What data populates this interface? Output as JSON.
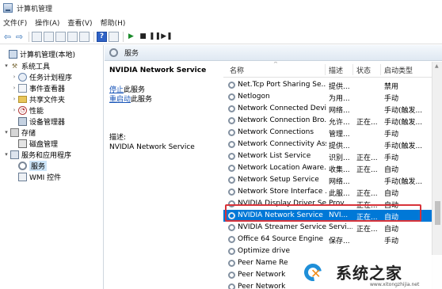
{
  "window": {
    "title": "计算机管理"
  },
  "menu": [
    "文件(F)",
    "操作(A)",
    "查看(V)",
    "帮助(H)"
  ],
  "tree": [
    {
      "label": "计算机管理(本地)",
      "level": 0,
      "caret": "",
      "icon": "computer-icon"
    },
    {
      "label": "系统工具",
      "level": 1,
      "caret": "▾",
      "icon": "tools-icon"
    },
    {
      "label": "任务计划程序",
      "level": 2,
      "caret": "›",
      "icon": "clock-icon"
    },
    {
      "label": "事件查看器",
      "level": 2,
      "caret": "›",
      "icon": "event-viewer-icon"
    },
    {
      "label": "共享文件夹",
      "level": 2,
      "caret": "›",
      "icon": "folder-icon"
    },
    {
      "label": "性能",
      "level": 2,
      "caret": "›",
      "icon": "performance-icon"
    },
    {
      "label": "设备管理器",
      "level": 2,
      "caret": "",
      "icon": "device-manager-icon"
    },
    {
      "label": "存储",
      "level": 1,
      "caret": "▾",
      "icon": "storage-icon"
    },
    {
      "label": "磁盘管理",
      "level": 2,
      "caret": "",
      "icon": "disk-icon"
    },
    {
      "label": "服务和应用程序",
      "level": 1,
      "caret": "▾",
      "icon": "services-apps-icon"
    },
    {
      "label": "服务",
      "level": 2,
      "caret": "",
      "icon": "gear-icon",
      "selected": true
    },
    {
      "label": "WMI 控件",
      "level": 2,
      "caret": "",
      "icon": "wmi-icon"
    }
  ],
  "pane_header": {
    "title": "服务"
  },
  "detail": {
    "title": "NVIDIA Network Service",
    "stop_link": "停止",
    "stop_suffix": "此服务",
    "restart_link": "重启动",
    "restart_suffix": "此服务",
    "desc_label": "描述:",
    "desc_text": "NVIDIA Network Service"
  },
  "columns": {
    "name": "名称",
    "desc": "描述",
    "status": "状态",
    "startup": "启动类型"
  },
  "services": [
    {
      "name": "Net.Tcp Port Sharing Se...",
      "desc": "提供...",
      "status": "",
      "startup": "禁用"
    },
    {
      "name": "Netlogon",
      "desc": "为用...",
      "status": "",
      "startup": "手动"
    },
    {
      "name": "Network Connected Devi...",
      "desc": "网络...",
      "status": "",
      "startup": "手动(触发..."
    },
    {
      "name": "Network Connection Bro...",
      "desc": "允许...",
      "status": "正在...",
      "startup": "手动(触发..."
    },
    {
      "name": "Network Connections",
      "desc": "管理...",
      "status": "",
      "startup": "手动"
    },
    {
      "name": "Network Connectivity Ass...",
      "desc": "提供...",
      "status": "",
      "startup": "手动(触发..."
    },
    {
      "name": "Network List Service",
      "desc": "识别...",
      "status": "正在...",
      "startup": "手动"
    },
    {
      "name": "Network Location Aware...",
      "desc": "收集...",
      "status": "正在...",
      "startup": "自动"
    },
    {
      "name": "Network Setup Service",
      "desc": "网络...",
      "status": "",
      "startup": "手动(触发..."
    },
    {
      "name": "Network Store Interface ...",
      "desc": "此服...",
      "status": "正在...",
      "startup": "自动"
    },
    {
      "name": "NVIDIA Display Driver Se...",
      "desc": "Prov...",
      "status": "正在...",
      "startup": "自动"
    },
    {
      "name": "NVIDIA Network Service",
      "desc": "NVI...",
      "status": "正在...",
      "startup": "自动",
      "highlight": true
    },
    {
      "name": "NVIDIA Streamer Service",
      "desc": "Servi...",
      "status": "正在...",
      "startup": "自动"
    },
    {
      "name": "Office 64 Source Engine",
      "desc": "保存...",
      "status": "",
      "startup": "手动"
    },
    {
      "name": "Optimize drive",
      "desc": "",
      "status": "",
      "startup": ""
    },
    {
      "name": "Peer Name Re",
      "desc": "",
      "status": "",
      "startup": ""
    },
    {
      "name": "Peer Network",
      "desc": "",
      "status": "",
      "startup": ""
    },
    {
      "name": "Peer Network",
      "desc": "",
      "status": "",
      "startup": ""
    }
  ],
  "watermark": {
    "text": "系统之家",
    "url": "www.xitongzhijia.net"
  },
  "colors": {
    "selection": "#0078d7",
    "annotation_box": "#d7333a",
    "link": "#1a56b8"
  }
}
